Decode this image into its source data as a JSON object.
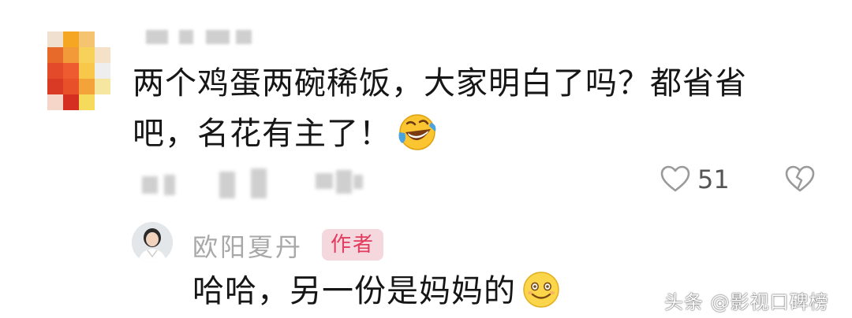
{
  "comment": {
    "text": "两个鸡蛋两碗稀饭，大家明白了吗？都省省吧，名花有主了！",
    "emoji": "laughing-tears-emoji",
    "like_count": "51"
  },
  "reply": {
    "author": "欧阳夏丹",
    "badge": "作者",
    "text": "哈哈，另一份是妈妈的",
    "emoji": "smiling-emoji"
  },
  "watermark": {
    "text": "头条 @影视口碑榜"
  },
  "colors": {
    "badge_bg": "#f5d7de",
    "badge_text": "#e23b5e",
    "muted_text": "#a8a8a8",
    "icon_gray": "#9a9a9a"
  }
}
